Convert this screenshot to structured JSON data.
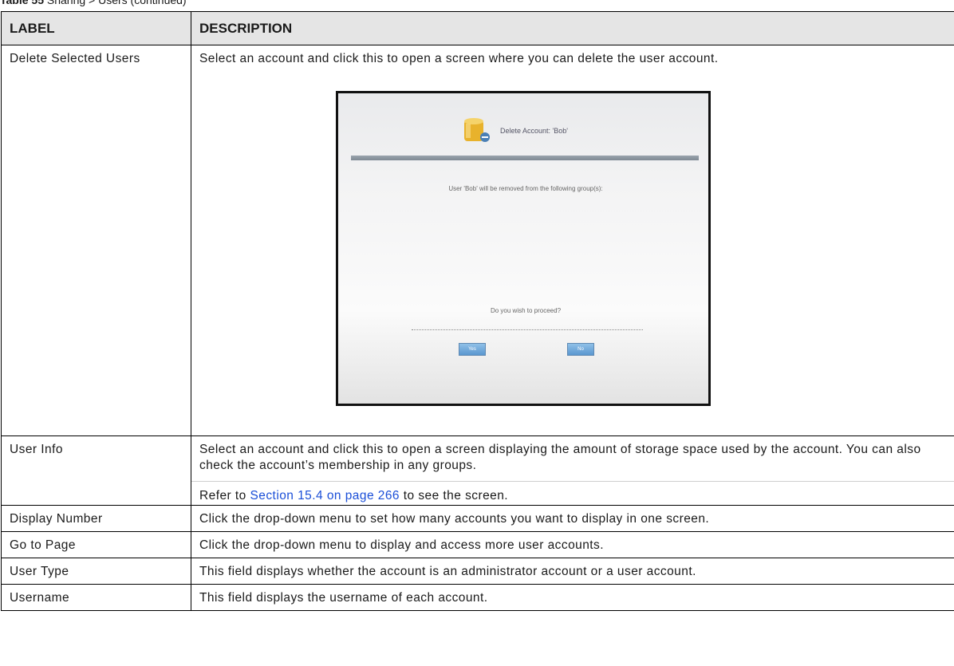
{
  "caption": {
    "table_no": "Table 55",
    "text": "Sharing > Users (continued)"
  },
  "table": {
    "headers": {
      "label": "LABEL",
      "description": "DESCRIPTION"
    },
    "rows": [
      {
        "label": "Delete Selected Users",
        "description": "Select an account and click this to open a screen where you can delete the user account."
      },
      {
        "label": "User Info",
        "description": "Select an account and click this to open a screen displaying the amount of storage space used by the account. You can also check the account’s membership in any groups.",
        "ref_prefix": "Refer to ",
        "ref_link": "Section 15.4 on page 266",
        "ref_suffix": " to see the screen."
      },
      {
        "label": "Display Number",
        "description": "Click the drop-down menu to set how many accounts you want to display in one screen."
      },
      {
        "label": "Go to Page",
        "description": "Click the drop-down menu to display and access more user accounts."
      },
      {
        "label": "User Type",
        "description": "This field displays whether the account is an administrator account or a user account."
      },
      {
        "label": "Username",
        "description": "This field displays the username of each account."
      }
    ]
  },
  "dialog": {
    "icon": "user-delete-icon",
    "title": "Delete Account: 'Bob'",
    "message": "User 'Bob' will be removed from the following group(s):",
    "question": "Do you wish to proceed?",
    "yes_label": "Yes",
    "no_label": "No"
  },
  "colors": {
    "header_bg": "#e5e5e5",
    "link": "#1b4fd8",
    "dialog_button": "#5a97cf"
  }
}
